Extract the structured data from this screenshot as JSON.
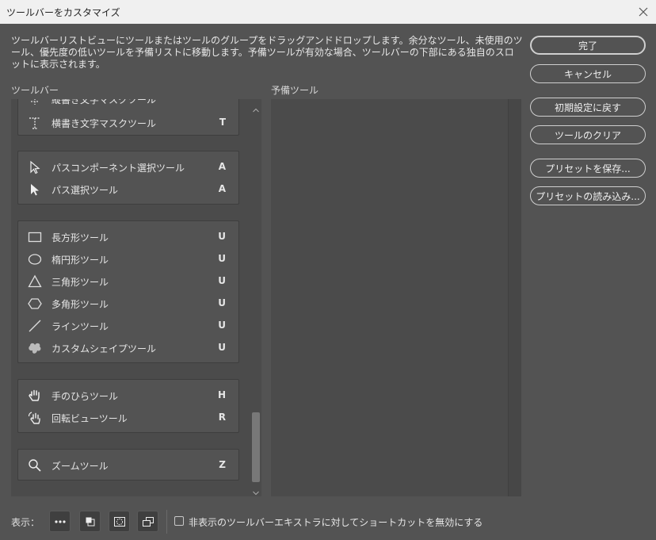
{
  "window": {
    "title": "ツールバーをカスタマイズ"
  },
  "description": "ツールバーリストビューにツールまたはツールのグループをドラッグアンドドロップします。余分なツール、未使用のツール、優先度の低いツールを予備リストに移動します。予備ツールが有効な場合、ツールバーの下部にある独自のスロットに表示されます。",
  "toolbar": {
    "label": "ツールバー",
    "groups": [
      {
        "tools": [
          {
            "name": "縦書き文字マスクツール",
            "key": "",
            "icon": "vertical-type-mask-icon"
          },
          {
            "name": "横書き文字マスクツール",
            "key": "T",
            "icon": "horizontal-type-mask-icon"
          }
        ]
      },
      {
        "tools": [
          {
            "name": "パスコンポーネント選択ツール",
            "key": "A",
            "icon": "path-component-selection-icon"
          },
          {
            "name": "パス選択ツール",
            "key": "A",
            "icon": "direct-selection-icon"
          }
        ]
      },
      {
        "tools": [
          {
            "name": "長方形ツール",
            "key": "U",
            "icon": "rectangle-icon"
          },
          {
            "name": "楕円形ツール",
            "key": "U",
            "icon": "ellipse-icon"
          },
          {
            "name": "三角形ツール",
            "key": "U",
            "icon": "triangle-icon"
          },
          {
            "name": "多角形ツール",
            "key": "U",
            "icon": "polygon-icon"
          },
          {
            "name": "ラインツール",
            "key": "U",
            "icon": "line-icon"
          },
          {
            "name": "カスタムシェイプツール",
            "key": "U",
            "icon": "custom-shape-icon"
          }
        ]
      },
      {
        "tools": [
          {
            "name": "手のひらツール",
            "key": "H",
            "icon": "hand-icon"
          },
          {
            "name": "回転ビューツール",
            "key": "R",
            "icon": "rotate-view-icon"
          }
        ]
      },
      {
        "tools": [
          {
            "name": "ズームツール",
            "key": "Z",
            "icon": "zoom-icon"
          }
        ]
      }
    ]
  },
  "extra_tools": {
    "label": "予備ツール"
  },
  "buttons": {
    "done": "完了",
    "cancel": "キャンセル",
    "restore_defaults": "初期設定に戻す",
    "clear_tools": "ツールのクリア",
    "save_preset": "プリセットを保存...",
    "load_preset": "プリセットの読み込み..."
  },
  "bottom": {
    "show_label": "表示：",
    "view_buttons": [
      "more-icon",
      "foreground-background-icon",
      "quick-mask-icon",
      "screen-mode-icon"
    ],
    "checkbox_label": "非表示のツールバーエキストラに対してショートカットを無効にする",
    "checkbox_checked": false
  }
}
